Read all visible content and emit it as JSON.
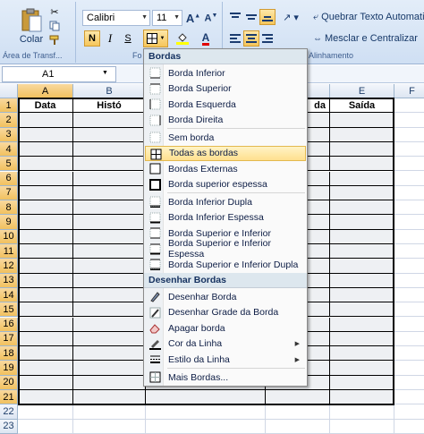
{
  "ribbon": {
    "paste_label": "Colar",
    "clipboard_group": "Área de Transf...",
    "font_group": "Fo",
    "alignment_group": "Alinhamento",
    "font_name": "Calibri",
    "font_size": "11",
    "bold": "N",
    "italic": "I",
    "underline": "S",
    "wrap_text": "Quebrar Texto Automatic",
    "merge_center": "Mesclar e Centralizar"
  },
  "formula_bar": {
    "name_box": "A1"
  },
  "columns": [
    "A",
    "B",
    "",
    "",
    "E",
    "F"
  ],
  "rows": [
    "1",
    "2",
    "3",
    "4",
    "5",
    "6",
    "7",
    "8",
    "9",
    "10",
    "11",
    "12",
    "13",
    "14",
    "15",
    "16",
    "17",
    "18",
    "19",
    "20",
    "21",
    "22",
    "23"
  ],
  "headers": {
    "a1": "Data",
    "b1": "Histó",
    "d1": "da",
    "e1": "Saída"
  },
  "menu": {
    "title": "Bordas",
    "items": [
      {
        "label": "Borda Inferior"
      },
      {
        "label": "Borda Superior"
      },
      {
        "label": "Borda Esquerda"
      },
      {
        "label": "Borda Direita"
      },
      {
        "label": "Sem borda"
      },
      {
        "label": "Todas as bordas"
      },
      {
        "label": "Bordas Externas"
      },
      {
        "label": "Borda superior espessa"
      },
      {
        "label": "Borda Inferior Dupla"
      },
      {
        "label": "Borda Inferior Espessa"
      },
      {
        "label": "Borda Superior e Inferior"
      },
      {
        "label": "Borda Superior e Inferior Espessa"
      },
      {
        "label": "Borda Superior e Inferior Dupla"
      }
    ],
    "draw_title": "Desenhar Bordas",
    "draw_items": [
      {
        "label": "Desenhar Borda"
      },
      {
        "label": "Desenhar Grade da Borda"
      },
      {
        "label": "Apagar borda"
      },
      {
        "label": "Cor da Linha"
      },
      {
        "label": "Estilo da Linha"
      }
    ],
    "more": "Mais Bordas..."
  },
  "colors": {
    "highlight": "#ffe08e",
    "selected_header": "#f1c15f",
    "ribbon": "#dbe7f6"
  }
}
